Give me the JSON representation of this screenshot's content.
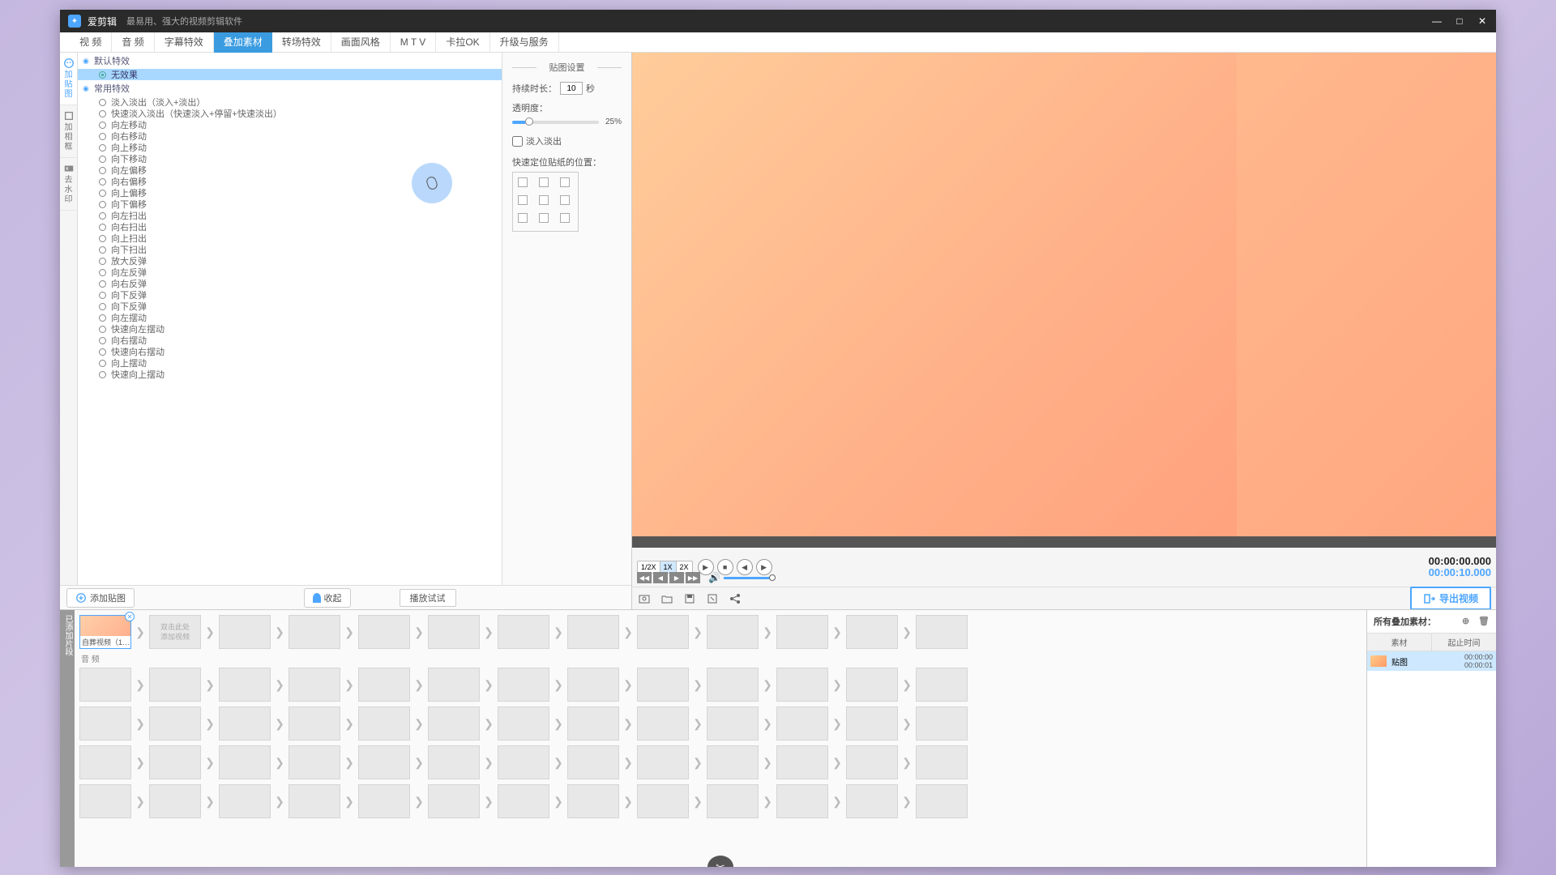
{
  "window": {
    "title": "爱剪辑",
    "subtitle": "最易用、强大的视频剪辑软件"
  },
  "tabs": [
    "视  频",
    "音  频",
    "字幕特效",
    "叠加素材",
    "转场特效",
    "画面风格",
    "M  T  V",
    "卡拉OK",
    "升级与服务"
  ],
  "active_tab": 3,
  "sidebar": {
    "items": [
      "加贴图",
      "加相框",
      "去水印"
    ]
  },
  "effects": {
    "group1": "默认特效",
    "selected_effect": "无效果",
    "group2": "常用特效",
    "list": [
      "淡入淡出（淡入+淡出）",
      "快速淡入淡出（快速淡入+停留+快速淡出）",
      "向左移动",
      "向右移动",
      "向上移动",
      "向下移动",
      "向左偏移",
      "向右偏移",
      "向上偏移",
      "向下偏移",
      "向左扫出",
      "向右扫出",
      "向上扫出",
      "向下扫出",
      "放大反弹",
      "向左反弹",
      "向右反弹",
      "向下反弹",
      "向下反弹",
      "向左摆动",
      "快速向左摆动",
      "向右摆动",
      "快速向右摆动",
      "向上摆动",
      "快速向上摆动"
    ]
  },
  "left_footer": {
    "add_sticker": "添加贴图",
    "collapse": "收起",
    "play_try": "播放试试"
  },
  "settings": {
    "title": "贴图设置",
    "duration_label": "持续时长：",
    "duration_value": "10",
    "duration_unit": "秒",
    "opacity_label": "透明度：",
    "opacity_value": "25%",
    "fade_label": "淡入淡出",
    "position_label": "快速定位贴纸的位置："
  },
  "playback": {
    "speeds": [
      "1/2X",
      "1X",
      "2X"
    ],
    "time_current": "00:00:00.000",
    "time_total": "00:00:10.000"
  },
  "export": {
    "label": "导出视频"
  },
  "clips": {
    "sidebar_label": "已添加片段",
    "first_clip": "自葬视频（1…",
    "placeholder": "双击此处\n添加视频",
    "audio_label": "音  频"
  },
  "materials": {
    "header": "所有叠加素材：",
    "col_material": "素材",
    "col_time": "起止时间",
    "row_name": "贴图",
    "row_time_start": "00:00:00",
    "row_time_end": "00:00:01"
  }
}
